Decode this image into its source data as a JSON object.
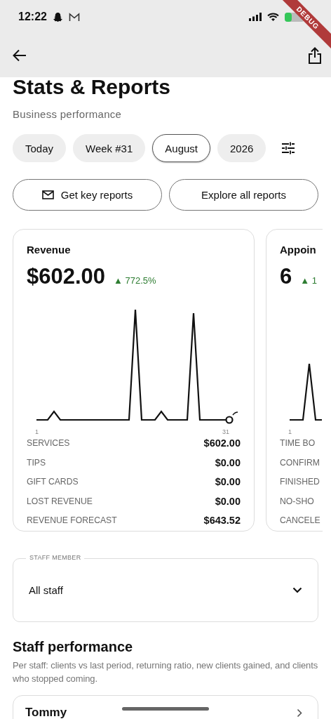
{
  "status_bar": {
    "time": "12:22"
  },
  "debug_banner": "DEBUG",
  "header": {
    "title": "Stats & Reports",
    "subtitle": "Business performance"
  },
  "period_chips": [
    {
      "label": "Today",
      "selected": false
    },
    {
      "label": "Week #31",
      "selected": false
    },
    {
      "label": "August",
      "selected": true
    },
    {
      "label": "2026",
      "selected": false
    }
  ],
  "report_buttons": [
    {
      "label": "Get key reports",
      "kind": "icon"
    },
    {
      "label": "Explore all reports",
      "kind": "plain"
    }
  ],
  "metric_cards": [
    {
      "kind": "revenue",
      "title": "Revenue",
      "value": "$602.00",
      "change": "▲ 772.5%",
      "axis_start": "1",
      "axis_end": "31",
      "rows": [
        {
          "label": "SERVICES",
          "value": "$602.00"
        },
        {
          "label": "TIPS",
          "value": "$0.00"
        },
        {
          "label": "GIFT CARDS",
          "value": "$0.00"
        },
        {
          "label": "LOST REVENUE",
          "value": "$0.00"
        },
        {
          "label": "REVENUE FORECAST",
          "value": "$643.52"
        }
      ]
    },
    {
      "kind": "appointments",
      "title": "Appoin",
      "value": "6",
      "change": "▲ 1",
      "axis_start": "1",
      "rows": [
        {
          "label": "TIME BO"
        },
        {
          "label": "CONFIRM"
        },
        {
          "label": "FINISHED"
        },
        {
          "label": "NO-SHO"
        },
        {
          "label": "CANCELE"
        }
      ]
    }
  ],
  "staff_select": {
    "label": "STAFF MEMBER",
    "value": "All staff"
  },
  "staff_performance": {
    "title": "Staff performance",
    "description": "Per staff: clients vs last period, returning ratio, new clients gained, and clients who stopped coming.",
    "staff": [
      {
        "name": "Tommy"
      }
    ]
  }
}
